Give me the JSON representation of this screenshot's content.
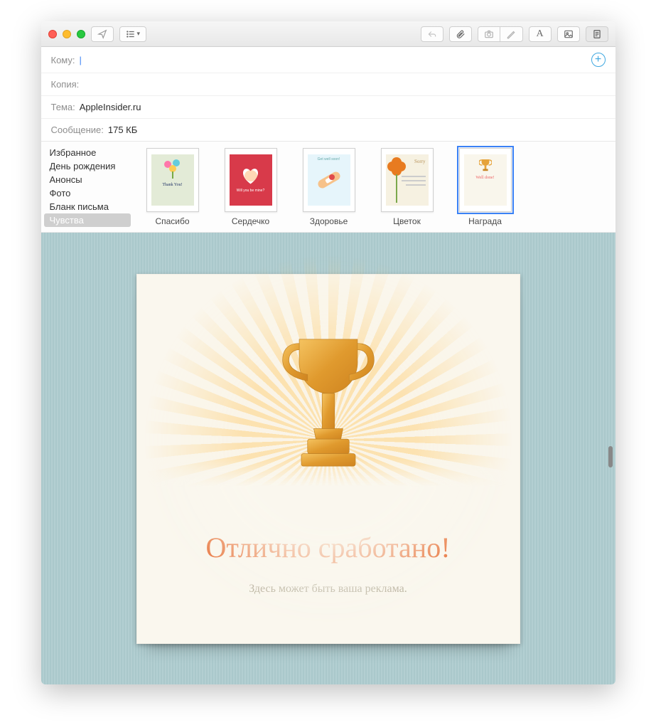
{
  "titlebar": {
    "traffic": {
      "close": "close",
      "min": "minimize",
      "max": "maximize"
    },
    "send": "send-icon",
    "list": "list-icon",
    "reply": "reply-icon",
    "attach": "attach-icon",
    "camera": "camera-icon",
    "font": "A",
    "photo": "photo-icon",
    "stationery": "stationery-icon"
  },
  "headers": {
    "to_label": "Кому:",
    "to_value": "",
    "cc_label": "Копия:",
    "cc_value": "",
    "subject_label": "Тема:",
    "subject_value": "AppleInsider.ru",
    "size_label": "Сообщение:",
    "size_value": "175 КБ"
  },
  "categories": [
    "Избранное",
    "День рождения",
    "Анонсы",
    "Фото",
    "Бланк письма",
    "Чувства"
  ],
  "categories_selected_index": 5,
  "templates": [
    {
      "label": "Спасибо",
      "thumb_text": "Thank You!"
    },
    {
      "label": "Сердечко",
      "thumb_text": "Will you be mine?"
    },
    {
      "label": "Здоровье",
      "thumb_text": "Get well soon!"
    },
    {
      "label": "Цветок",
      "thumb_text": "Sorry"
    },
    {
      "label": "Награда",
      "thumb_text": "Well done!"
    }
  ],
  "templates_selected_index": 4,
  "card": {
    "headline": "Отлично сработано!",
    "subline": "Здесь может быть ваша реклама."
  }
}
